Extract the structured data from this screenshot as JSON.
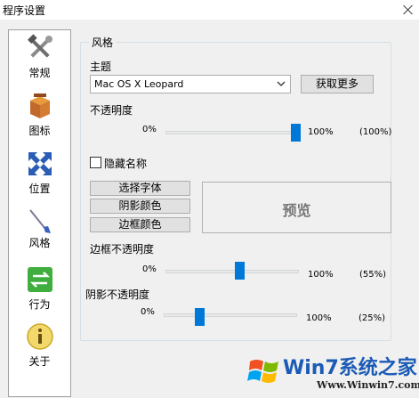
{
  "window": {
    "title": "程序设置"
  },
  "sidebar": {
    "items": [
      {
        "label": "常规",
        "icon": "tools-icon"
      },
      {
        "label": "图标",
        "icon": "box-icon"
      },
      {
        "label": "位置",
        "icon": "arrows-icon"
      },
      {
        "label": "风格",
        "icon": "brush-icon",
        "active": true
      },
      {
        "label": "行为",
        "icon": "exchange-icon"
      },
      {
        "label": "关于",
        "icon": "info-icon"
      }
    ]
  },
  "style_group": {
    "title": "风格",
    "theme_label": "主题",
    "theme_value": "Mac OS X Leopard",
    "get_more_button": "获取更多",
    "opacity": {
      "label": "不透明度",
      "min": "0%",
      "max": "100%",
      "value_text": "(100%)",
      "value": 1.0
    },
    "hide_names_label": "隐藏名称",
    "hide_names_checked": false,
    "select_font_button": "选择字体",
    "shadow_color_button": "阴影颜色",
    "border_color_button": "边框颜色",
    "preview_text": "预览",
    "border_opacity": {
      "label": "边框不透明度",
      "min": "0%",
      "max": "100%",
      "value_text": "(55%)",
      "value": 0.55
    },
    "shadow_opacity": {
      "label": "阴影不透明度",
      "min": "0%",
      "max": "100%",
      "value_text": "(25%)",
      "value": 0.25
    }
  },
  "watermark": {
    "brand": "Win7系统之家",
    "url": "Www.Winwin7.com"
  },
  "colors": {
    "accent": "#0078d7",
    "watermark_blue": "#1b5bb5"
  }
}
